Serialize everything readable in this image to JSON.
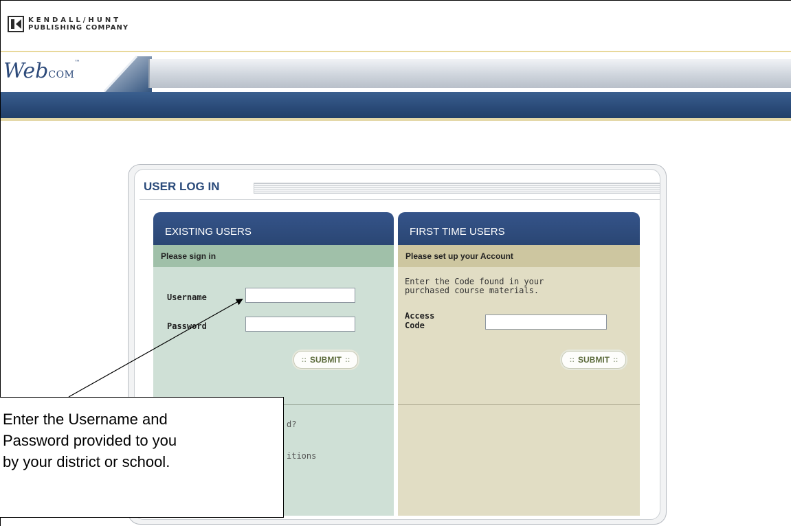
{
  "header": {
    "publisher_line1": "KENDALL/HUNT",
    "publisher_line2": "PUBLISHING COMPANY",
    "product_name": "Web",
    "product_suffix": "COM",
    "product_tm": "™"
  },
  "login": {
    "title": "USER LOG IN",
    "existing": {
      "heading": "EXISTING USERS",
      "subheading": "Please sign in",
      "username_label": "Username",
      "username_value": "",
      "password_label": "Password",
      "password_value": "",
      "submit_label": "SUBMIT",
      "link1_partial": "d?",
      "link2_partial": "itions"
    },
    "first_time": {
      "heading": "FIRST TIME USERS",
      "subheading": "Please set up your Account",
      "instructions_line1": "Enter the Code found in your",
      "instructions_line2": "purchased course materials.",
      "access_label_line1": "Access",
      "access_label_line2": "Code",
      "access_value": "",
      "submit_label": "SUBMIT"
    }
  },
  "callout": {
    "text": "Enter the Username and\nPassword provided to you\nby your district or school."
  },
  "icons": {
    "publisher_logo": "kendall-hunt-logo-icon",
    "button_dots": "::"
  },
  "colors": {
    "brand_blue": "#2a4a7a",
    "existing_panel": "#cfe0d6",
    "first_time_panel": "#e1ddc4"
  }
}
